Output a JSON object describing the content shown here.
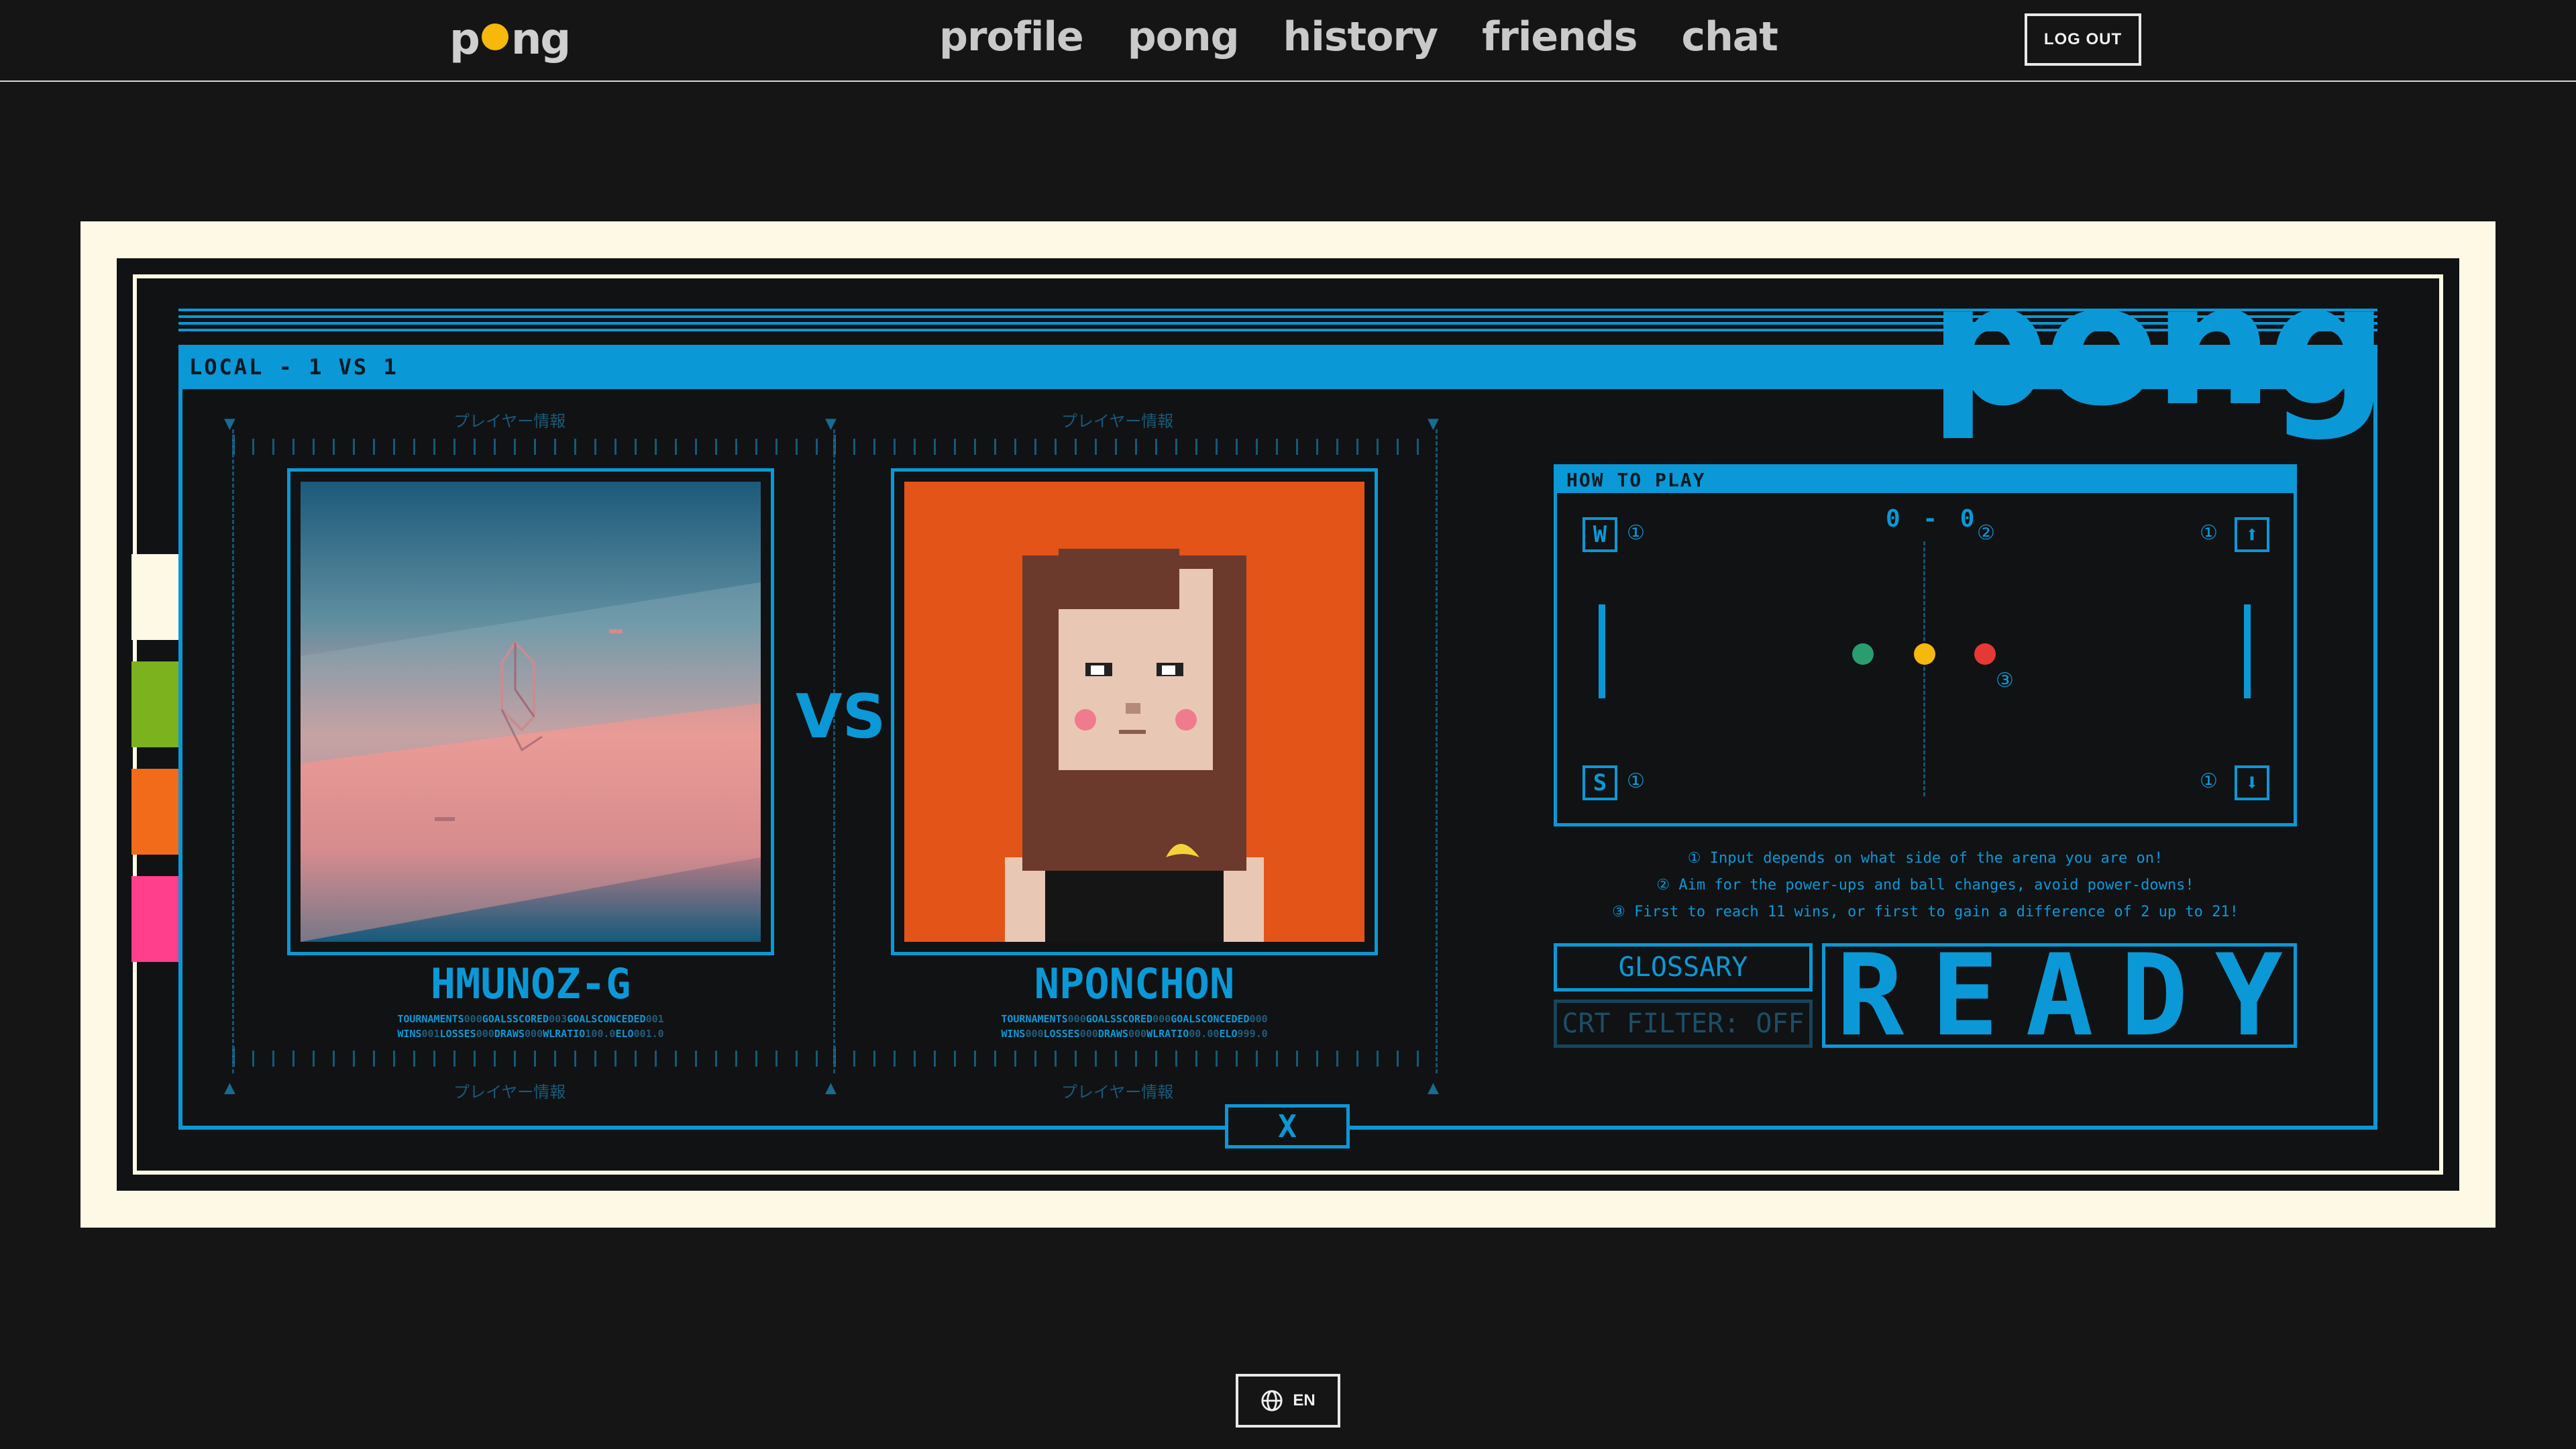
{
  "header": {
    "logo_left": "p",
    "logo_right": "ng",
    "nav": [
      "profile",
      "pong",
      "history",
      "friends",
      "chat"
    ],
    "logout": "LOG OUT"
  },
  "game": {
    "mode_label": "LOCAL - 1 VS 1",
    "brand": "pong",
    "jp_label": "プレイヤー情報",
    "vs": "VS",
    "player1": {
      "name": "HMUNOZ-G",
      "stats_line1": [
        [
          "TOURNAMENTS",
          "000"
        ],
        [
          "GOALSSCORED",
          "003"
        ],
        [
          "GOALSCONCEDED",
          "001"
        ]
      ],
      "stats_line2": [
        [
          "WINS",
          "001"
        ],
        [
          "LOSSES",
          "000"
        ],
        [
          "DRAWS",
          "000"
        ],
        [
          "WLRATIO",
          "100.0"
        ],
        [
          "ELO",
          "001.0"
        ]
      ]
    },
    "player2": {
      "name": "NPONCHON",
      "stats_line1": [
        [
          "TOURNAMENTS",
          "000"
        ],
        [
          "GOALSSCORED",
          "000"
        ],
        [
          "GOALSCONCEDED",
          "000"
        ]
      ],
      "stats_line2": [
        [
          "WINS",
          "000"
        ],
        [
          "LOSSES",
          "000"
        ],
        [
          "DRAWS",
          "000"
        ],
        [
          "WLRATIO",
          "00.00"
        ],
        [
          "ELO",
          "999.0"
        ]
      ]
    },
    "how_to_play": {
      "title": "HOW TO PLAY",
      "score": "0 - 0",
      "key_up_left": "W",
      "key_down_left": "S",
      "key_up_right": "⬆",
      "key_down_right": "⬇",
      "mark1": "①",
      "mark2": "②",
      "mark3": "③",
      "rules": [
        "① Input depends on what side of the arena you are on!",
        "② Aim for the power-ups and ball changes, avoid power-downs!",
        "③ First to reach 11 wins, or first to gain a difference of 2 up to 21!"
      ]
    },
    "glossary": "GLOSSARY",
    "crt_filter": "CRT FILTER: OFF",
    "ready": "READY",
    "close": "X"
  },
  "footer": {
    "language": "EN"
  },
  "colors": {
    "accent": "#0b98d6",
    "frame": "#fdf9e5",
    "background": "#151515",
    "ball_green": "#2a9d6e",
    "ball_yellow": "#f5b80b",
    "ball_red": "#e53935"
  },
  "side_colors": [
    "#ffffff",
    "#7bb21e",
    "#f26b1a",
    "#ff3f8b"
  ]
}
